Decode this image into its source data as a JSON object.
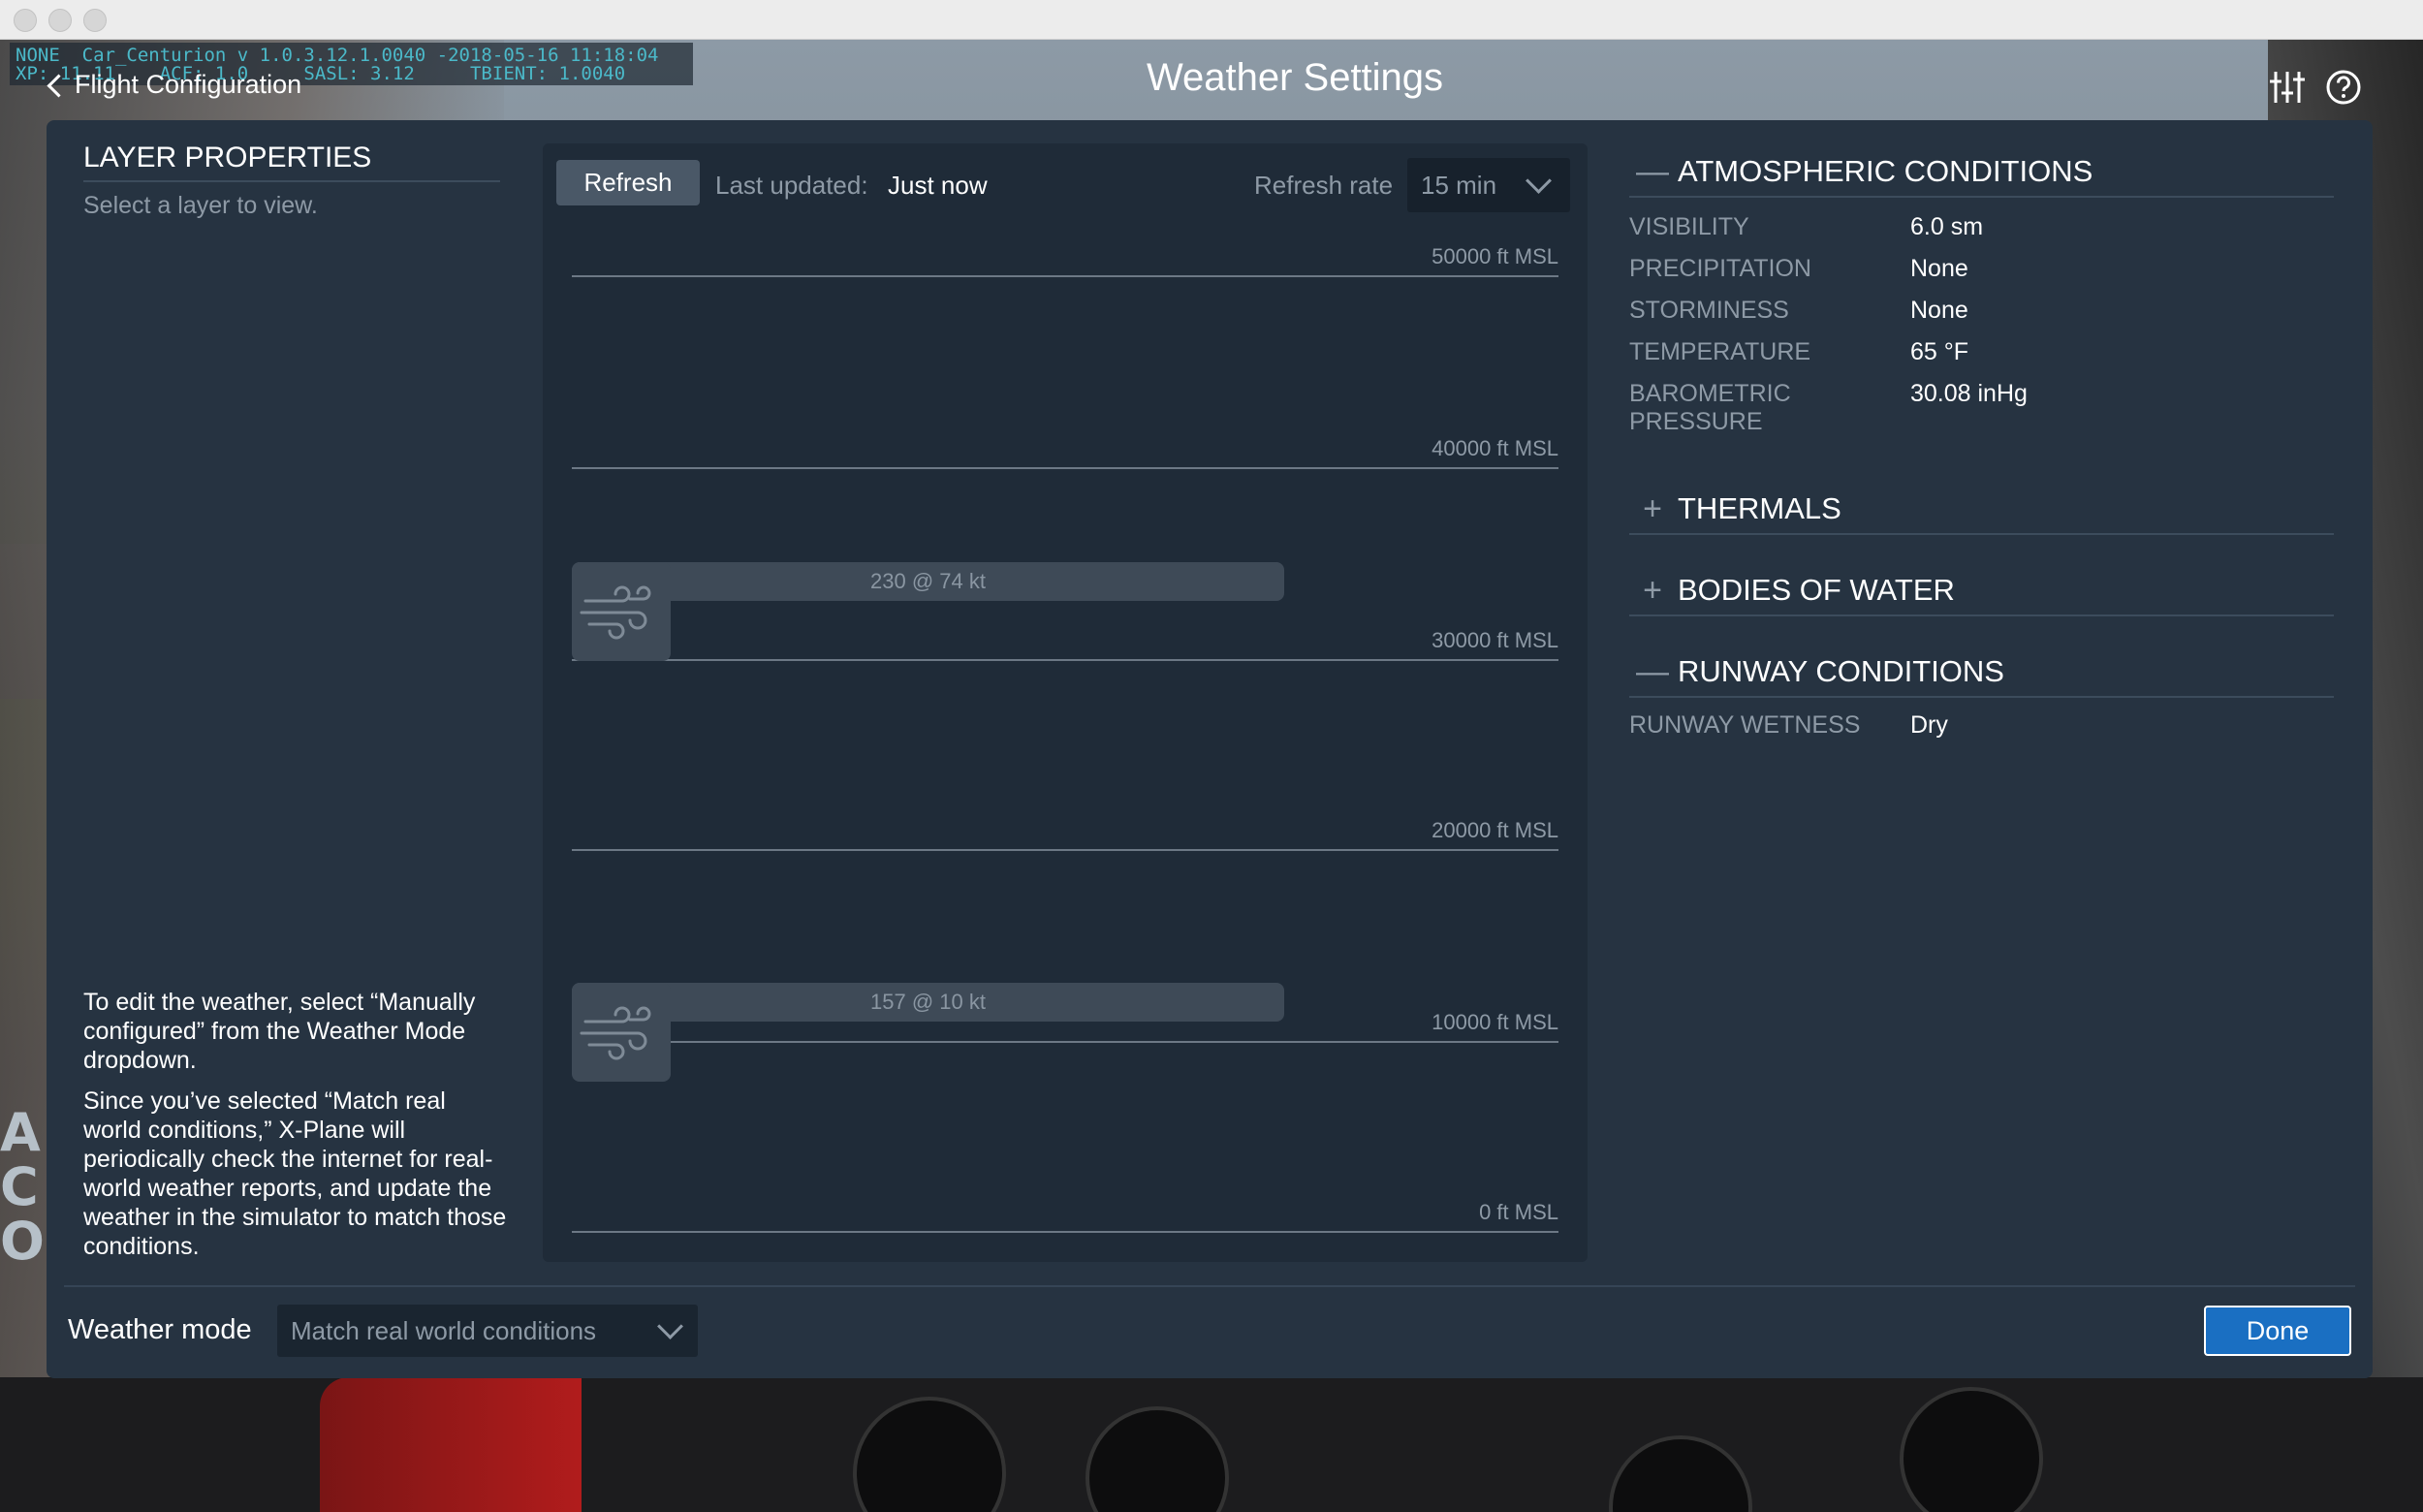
{
  "debug": {
    "line1": "NONE  Car_Centurion v 1.0.3.12.1.0040 -2018-05-16 11:18:04",
    "line2": "XP: 11.11    ACF: 1.0     SASL: 3.12     TBIENT: 1.0040"
  },
  "header": {
    "back_label": "Flight Configuration",
    "title": "Weather Settings"
  },
  "left_panel": {
    "title": "LAYER PROPERTIES",
    "subtitle": "Select a layer to view.",
    "help_1": "To edit the weather, select “Manually configured” from the Weather Mode dropdown.",
    "help_2": "Since you’ve selected “Match real world conditions,” X-Plane will periodically check the internet for real-world weather reports, and update the weather in the simulator to match those conditions."
  },
  "layers": {
    "refresh_label": "Refresh",
    "last_updated_label": "Last updated:",
    "last_updated_value": "Just now",
    "refresh_rate_label": "Refresh rate",
    "refresh_rate_value": "15 min",
    "altitudes": [
      "50000 ft MSL",
      "40000 ft MSL",
      "30000 ft MSL",
      "20000 ft MSL",
      "10000 ft MSL",
      "0 ft MSL"
    ],
    "wind_layers": [
      "230 @ 74 kt",
      "157 @ 10 kt"
    ]
  },
  "atmospheric": {
    "title": "ATMOSPHERIC CONDITIONS",
    "toggle": "—",
    "rows": [
      {
        "label": "VISIBILITY",
        "value": "6.0 sm"
      },
      {
        "label": "PRECIPITATION",
        "value": "None"
      },
      {
        "label": "STORMINESS",
        "value": "None"
      },
      {
        "label": "TEMPERATURE",
        "value": "65 °F"
      },
      {
        "label": "BAROMETRIC PRESSURE",
        "value": "30.08 inHg"
      }
    ]
  },
  "thermals": {
    "title": "THERMALS",
    "toggle": "+"
  },
  "bodies_of_water": {
    "title": "BODIES OF WATER",
    "toggle": "+"
  },
  "runway": {
    "title": "RUNWAY CONDITIONS",
    "toggle": "—",
    "wetness_label": "RUNWAY WETNESS",
    "wetness_value": "Dry"
  },
  "footer": {
    "weather_mode_label": "Weather mode",
    "weather_mode_value": "Match real world conditions",
    "done_label": "Done"
  },
  "colors": {
    "window_bg": "#263341",
    "chart_bg": "#1f2b38",
    "accent": "#1a6fc2"
  },
  "icons": [
    "back-chevron-icon",
    "settings-sliders-icon",
    "help-icon",
    "wind-icon",
    "chevron-down-icon"
  ]
}
